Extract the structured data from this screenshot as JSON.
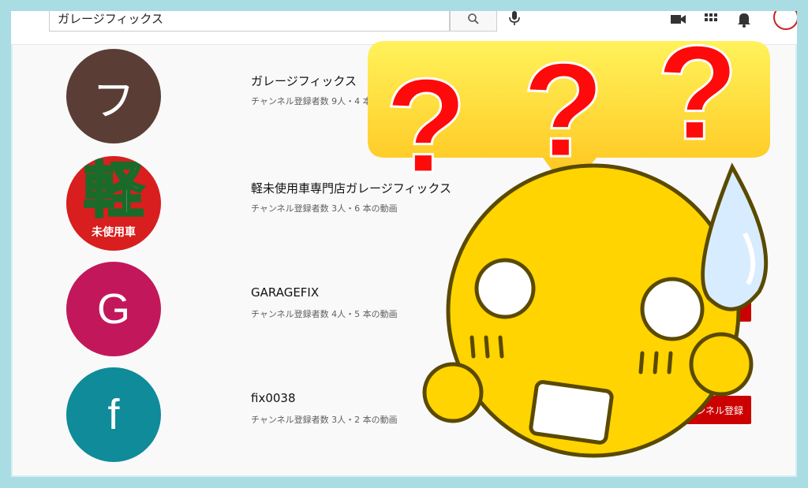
{
  "search": {
    "query": "ガレージフィックス"
  },
  "channels": [
    {
      "initial": "フ",
      "color": "#5a3e36",
      "name": "ガレージフィックス",
      "meta": "チャンネル登録者数 9人・4 本"
    },
    {
      "initial": "軽",
      "color": "#d81e1e",
      "name": "軽未使用車専門店ガレージフィックス",
      "meta": "チャンネル登録者数 3人・6 本の動画",
      "avatar_sub": "未使用車"
    },
    {
      "initial": "G",
      "color": "#c2185b",
      "name": "GARAGEFIX",
      "meta": "チャンネル登録者数 4人・5 本の動画"
    },
    {
      "initial": "f",
      "color": "#0f8b9a",
      "name": "fix0038",
      "meta": "チャンネル登録者数 3人・2 本の動画"
    }
  ],
  "subscribe_label": "ャンネル登録",
  "icons": [
    "search-icon",
    "mic-icon",
    "video-camera-icon",
    "apps-grid-icon",
    "bell-icon",
    "account-avatar"
  ],
  "overlay": {
    "marks": [
      "?",
      "?",
      "?"
    ],
    "mark_color": "#ff0a0a",
    "bubble_color": "#ffd21a",
    "face_color": "#ffd400"
  }
}
